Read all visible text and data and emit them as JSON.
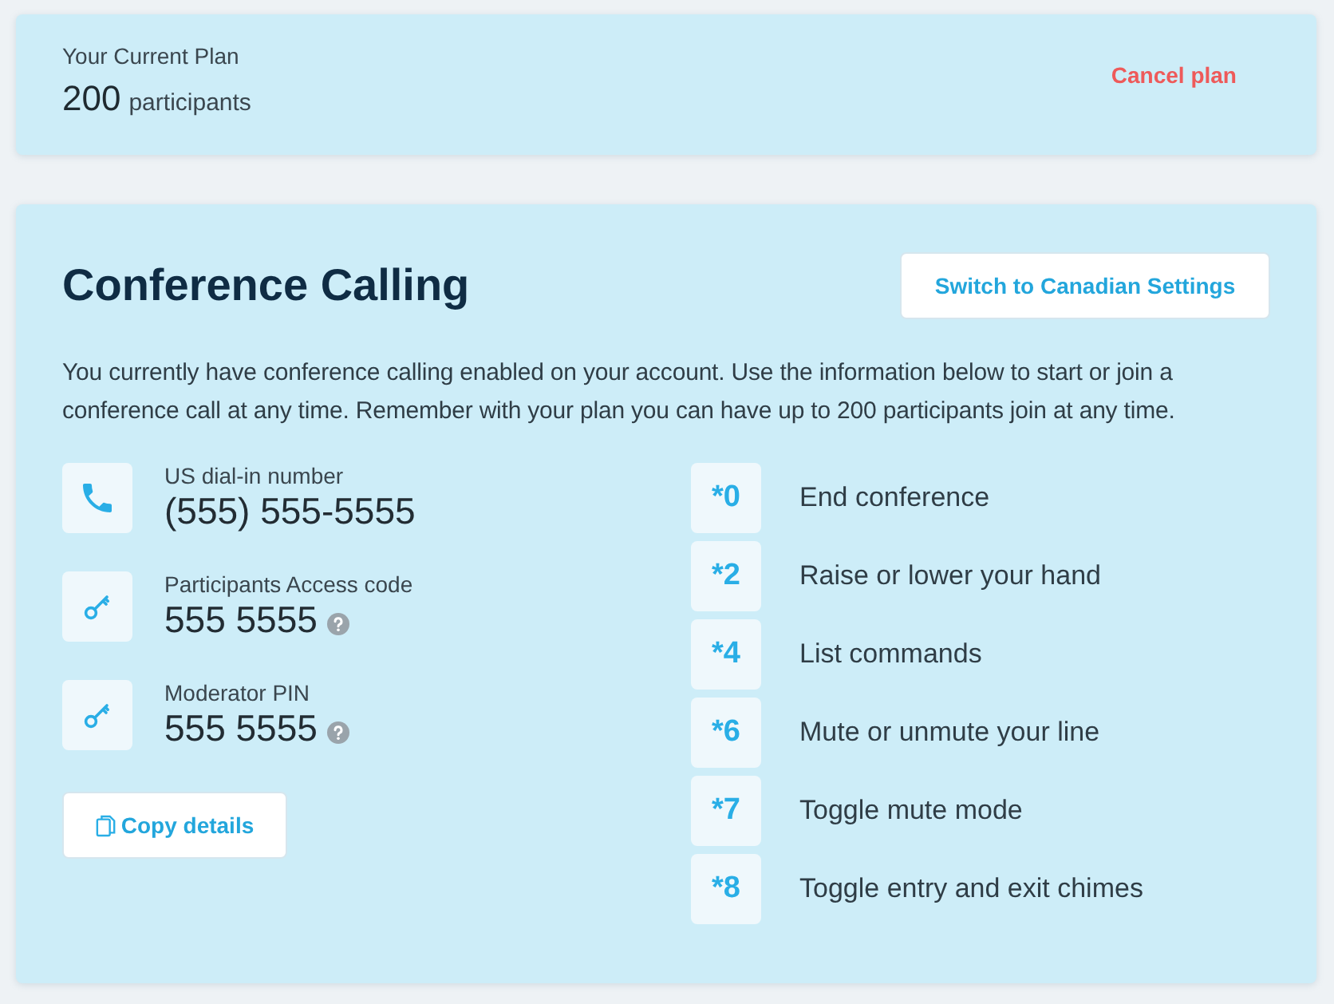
{
  "plan": {
    "label": "Your Current Plan",
    "count": "200",
    "unit": "participants",
    "cancel": "Cancel plan"
  },
  "conference": {
    "title": "Conference Calling",
    "switch_button": "Switch to Canadian Settings",
    "description": "You currently have conference calling enabled on your account. Use the information below to start or join a conference call at any time. Remember with your plan you can have up to 200 participants join at any time.",
    "details": [
      {
        "kind": "phone",
        "label": "US dial-in number",
        "value": "(555) 555-5555",
        "help": false
      },
      {
        "kind": "key",
        "label": "Participants Access code",
        "value": "555 5555",
        "help": true
      },
      {
        "kind": "key",
        "label": "Moderator PIN",
        "value": "555 5555",
        "help": true
      }
    ],
    "copy_button": "Copy details",
    "commands": [
      {
        "code": "*0",
        "action": "End conference"
      },
      {
        "code": "*2",
        "action": "Raise or lower your hand"
      },
      {
        "code": "*4",
        "action": "List commands"
      },
      {
        "code": "*6",
        "action": "Mute or unmute your line"
      },
      {
        "code": "*7",
        "action": "Toggle mute mode"
      },
      {
        "code": "*8",
        "action": "Toggle entry and exit chimes"
      }
    ]
  }
}
